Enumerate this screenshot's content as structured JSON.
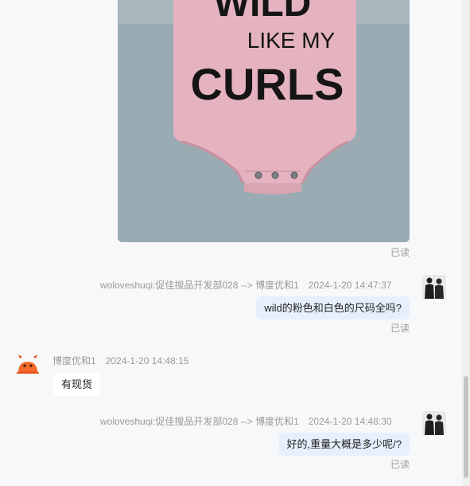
{
  "photo": {
    "print_lines": [
      "WILD",
      "LIKE MY",
      "CURLS"
    ]
  },
  "messages": [
    {
      "read_status": "已读"
    },
    {
      "sender": "woloveshuqi:促佳搜品开发部028 --> 博度优和1",
      "time": "2024-1-20 14:47:37",
      "text": "wild的粉色和白色的尺码全吗?",
      "read_status": "已读"
    },
    {
      "sender": "博度优和1",
      "time": "2024-1-20 14:48:15",
      "text": "有现货"
    },
    {
      "sender": "woloveshuqi:促佳搜品开发部028 --> 博度优和1",
      "time": "2024-1-20 14:48:30",
      "text": "好的,重量大概是多少呢/?",
      "read_status": "已读"
    }
  ],
  "colors": {
    "outgoing_bubble": "#e6f0fd",
    "incoming_bubble": "#ffffff",
    "muted_text": "#999999"
  }
}
